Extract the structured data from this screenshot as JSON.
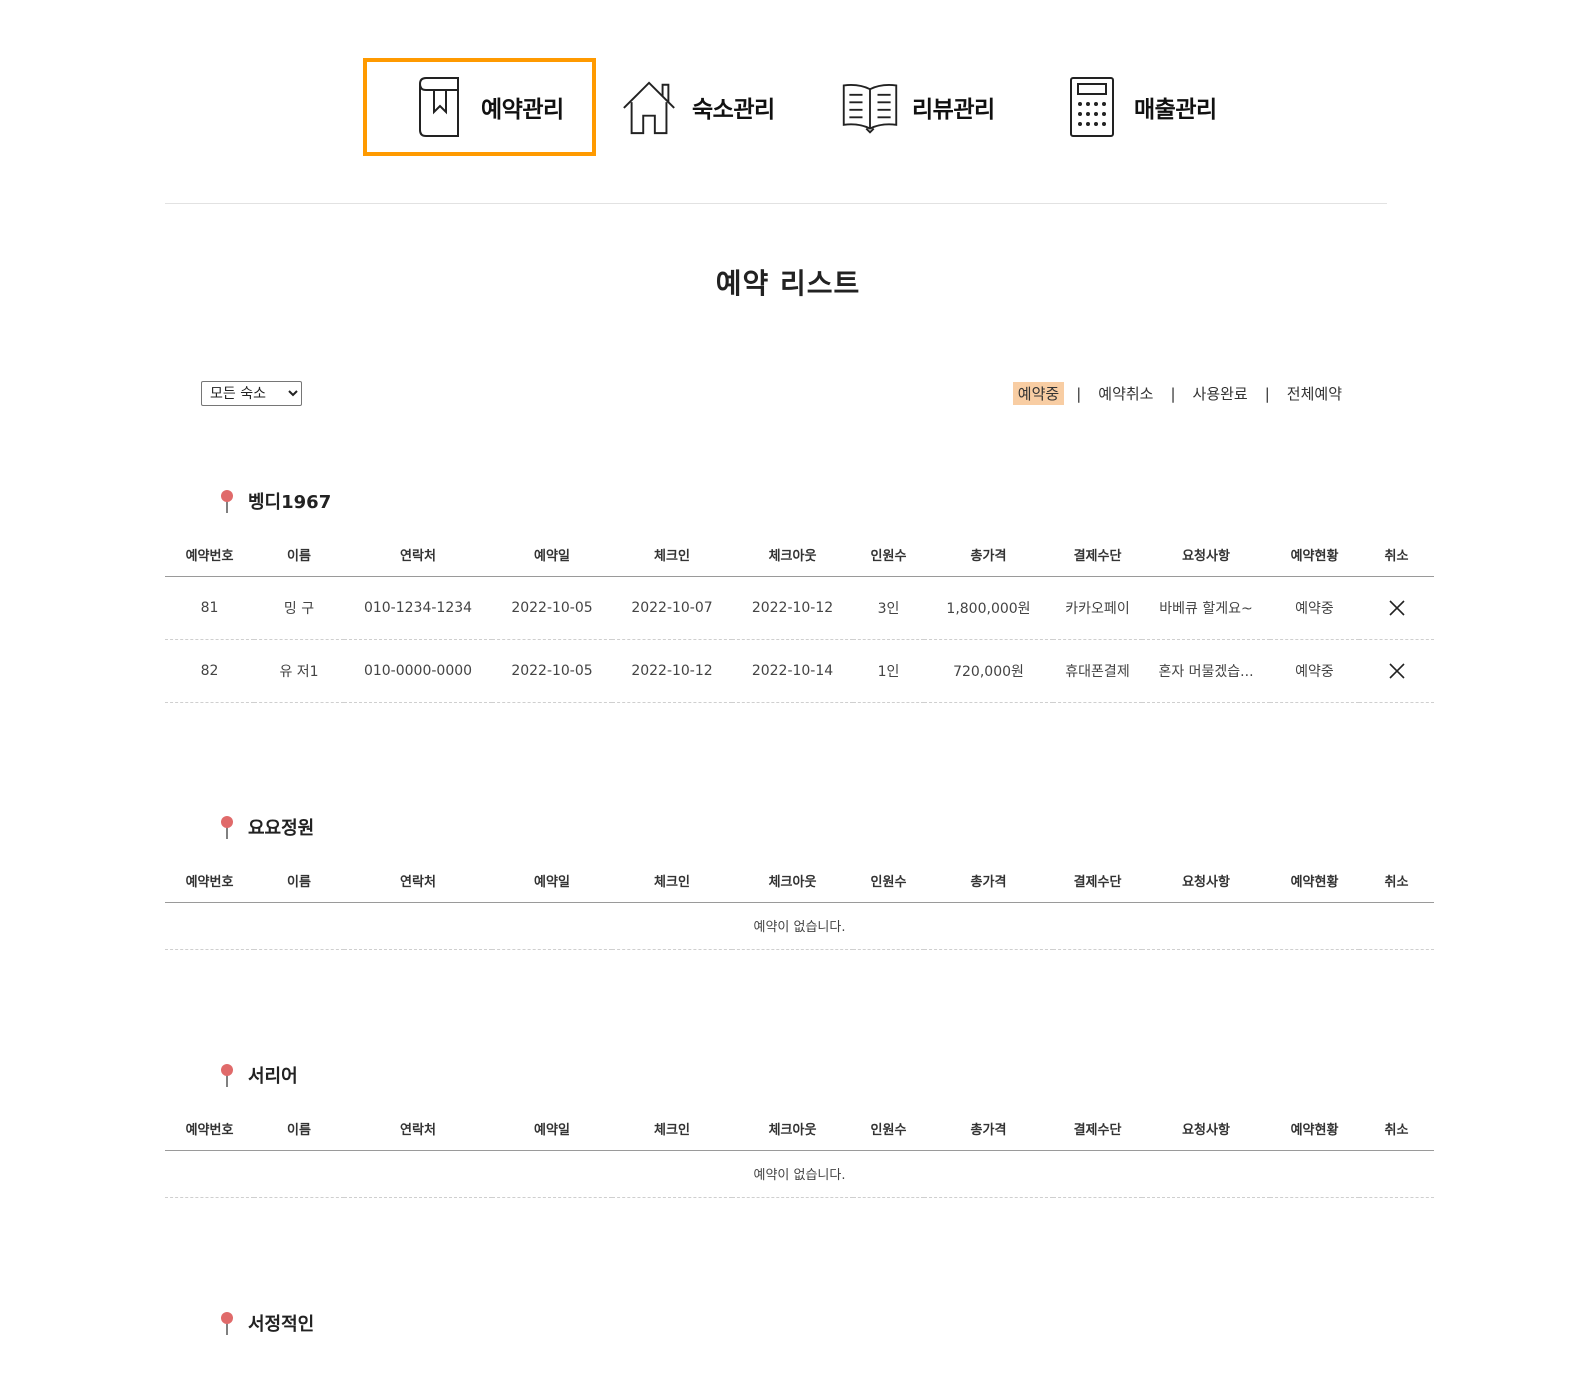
{
  "nav": {
    "items": [
      {
        "label": "예약관리",
        "icon": "bookmark-book-icon",
        "active": true
      },
      {
        "label": "숙소관리",
        "icon": "house-icon",
        "active": false
      },
      {
        "label": "리뷰관리",
        "icon": "open-book-icon",
        "active": false
      },
      {
        "label": "매출관리",
        "icon": "calculator-icon",
        "active": false
      }
    ],
    "active_color": "#ff9a00"
  },
  "page_title": "예약 리스트",
  "lodging_select": {
    "selected": "모든 숙소"
  },
  "status_filter": {
    "items": [
      "예약중",
      "예약취소",
      "사용완료",
      "전체예약"
    ],
    "active": "예약중",
    "active_color": "#f8cda3"
  },
  "columns": [
    "예약번호",
    "이름",
    "연락처",
    "예약일",
    "체크인",
    "체크아웃",
    "인원수",
    "총가격",
    "결제수단",
    "요청사항",
    "예약현황",
    "취소"
  ],
  "sections": [
    {
      "name": "벵디1967",
      "rows": [
        {
          "no": "81",
          "name": "밍 구",
          "phone": "010-1234-1234",
          "reserved": "2022-10-05",
          "checkin": "2022-10-07",
          "checkout": "2022-10-12",
          "guests": "3인",
          "price": "1,800,000원",
          "payment": "카카오페이",
          "request": "바베큐 할게요~",
          "status": "예약중"
        },
        {
          "no": "82",
          "name": "유 저1",
          "phone": "010-0000-0000",
          "reserved": "2022-10-05",
          "checkin": "2022-10-12",
          "checkout": "2022-10-14",
          "guests": "1인",
          "price": "720,000원",
          "payment": "휴대폰결제",
          "request": "혼자 머물겠습...",
          "status": "예약중"
        }
      ]
    },
    {
      "name": "요요정원",
      "empty_text": "예약이 없습니다."
    },
    {
      "name": "서리어",
      "empty_text": "예약이 없습니다."
    },
    {
      "name": "서정적인"
    }
  ],
  "pin_color": "#e06a6a"
}
